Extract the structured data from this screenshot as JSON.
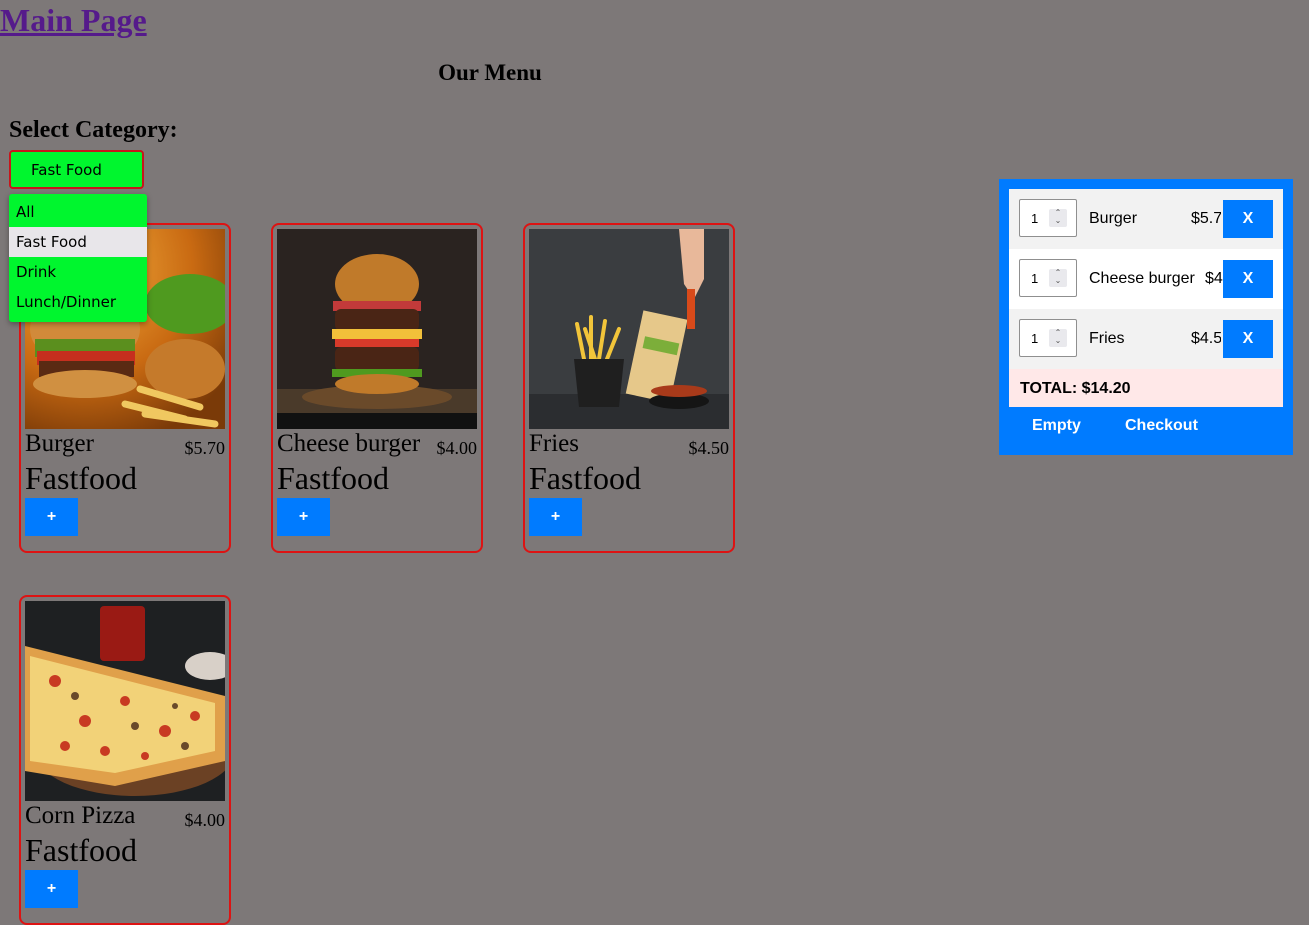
{
  "nav": {
    "main_link": "Main Page"
  },
  "menu": {
    "title": "Our Menu"
  },
  "filter": {
    "label": "Select Category:",
    "selected": "Fast Food",
    "options": [
      "All",
      "Fast Food",
      "Drink",
      "Lunch/Dinner"
    ]
  },
  "products": [
    {
      "name": "Burger",
      "price": "$5.70",
      "category": "Fastfood",
      "add_label": "+"
    },
    {
      "name": "Cheese burger",
      "price": "$4.00",
      "category": "Fastfood",
      "add_label": "+"
    },
    {
      "name": "Fries",
      "price": "$4.50",
      "category": "Fastfood",
      "add_label": "+"
    },
    {
      "name": "Corn Pizza",
      "price": "$4.00",
      "category": "Fastfood",
      "add_label": "+"
    }
  ],
  "cart": {
    "items": [
      {
        "qty": "1",
        "name": "Burger",
        "price": "$5.7",
        "remove_label": "X"
      },
      {
        "qty": "1",
        "name": "Cheese burger",
        "price": "$4",
        "remove_label": "X"
      },
      {
        "qty": "1",
        "name": "Fries",
        "price": "$4.5",
        "remove_label": "X"
      }
    ],
    "total": "TOTAL: $14.20",
    "empty_label": "Empty",
    "checkout_label": "Checkout"
  },
  "colors": {
    "page_bg": "#7d7878",
    "accent": "#007bff",
    "select_green": "#00f62e",
    "card_border": "#dd1313"
  }
}
